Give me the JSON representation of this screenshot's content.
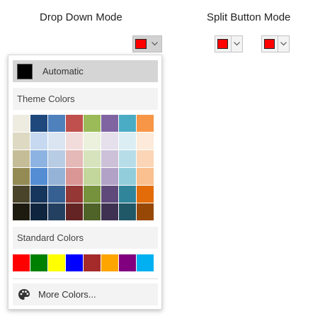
{
  "labels": {
    "dropdown_mode": "Drop Down Mode",
    "split_button_mode": "Split Button Mode"
  },
  "buttons": {
    "selected_color": "#FF0000",
    "caret_icon": "chevron-down-icon"
  },
  "popup": {
    "automatic": {
      "label": "Automatic",
      "color": "#000000"
    },
    "theme_header": "Theme Colors",
    "theme_colors": [
      "#EEECE1",
      "#1F497D",
      "#4F81BD",
      "#C0504D",
      "#9BBB59",
      "#8064A2",
      "#4BACC6",
      "#F79646",
      "#DDD9C3",
      "#C6D9F0",
      "#DBE5F1",
      "#F2DCDB",
      "#EBF1DD",
      "#E5E0EC",
      "#DBEEF3",
      "#FDEADA",
      "#C4BD97",
      "#8DB3E2",
      "#B8CCE4",
      "#E5B9B7",
      "#D7E3BC",
      "#CCC1D9",
      "#B7DDE8",
      "#FBD5B5",
      "#948A54",
      "#548DD4",
      "#95B3D7",
      "#D99694",
      "#C3D69B",
      "#B2A2C7",
      "#92CDDC",
      "#FAC08F",
      "#4A452A",
      "#17365D",
      "#366092",
      "#953734",
      "#76923C",
      "#5F497A",
      "#31859B",
      "#E36C09",
      "#1D1B10",
      "#0F243E",
      "#244061",
      "#632423",
      "#4F6228",
      "#3F3151",
      "#205867",
      "#974806"
    ],
    "standard_header": "Standard Colors",
    "standard_colors": [
      "#FF0000",
      "#008000",
      "#FFFF00",
      "#0000FF",
      "#A52A2A",
      "#FFA500",
      "#800080",
      "#00B0F0"
    ],
    "more_colors": {
      "label": "More Colors...",
      "icon": "palette-icon"
    }
  }
}
